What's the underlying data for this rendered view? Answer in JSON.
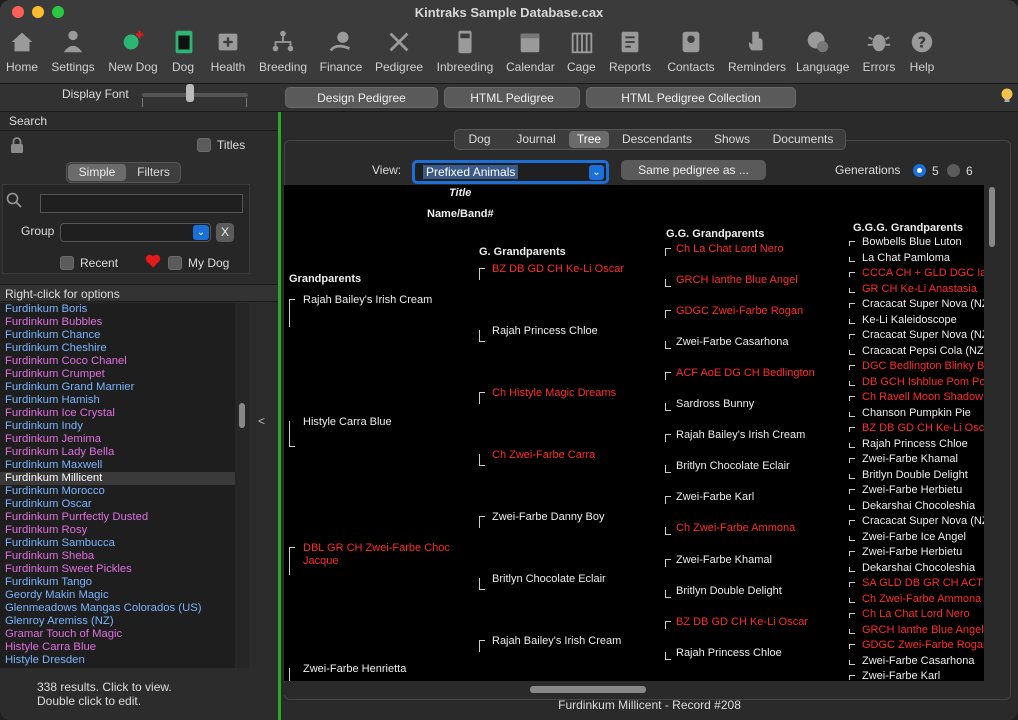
{
  "window": {
    "title": "Kintraks Sample Database.cax"
  },
  "toolbar": [
    {
      "label": "Home",
      "icon": "home-icon"
    },
    {
      "label": "Settings",
      "icon": "settings-person-icon"
    },
    {
      "label": "New Dog",
      "icon": "new-dog-icon"
    },
    {
      "label": "Dog",
      "icon": "dog-clipboard-icon"
    },
    {
      "label": "Health",
      "icon": "health-icon"
    },
    {
      "label": "Breeding",
      "icon": "breeding-icon"
    },
    {
      "label": "Finance",
      "icon": "finance-icon"
    },
    {
      "label": "Pedigree",
      "icon": "pedigree-icon"
    },
    {
      "label": "Inbreeding",
      "icon": "calculator-icon"
    },
    {
      "label": "Calendar",
      "icon": "calendar-icon"
    },
    {
      "label": "Cage",
      "icon": "cage-icon"
    },
    {
      "label": "Reports",
      "icon": "reports-icon"
    },
    {
      "label": "Contacts",
      "icon": "contacts-icon"
    },
    {
      "label": "Reminders",
      "icon": "reminders-icon"
    },
    {
      "label": "Language",
      "icon": "language-icon"
    },
    {
      "label": "Errors",
      "icon": "bug-icon"
    },
    {
      "label": "Help",
      "icon": "help-icon"
    }
  ],
  "fontbar": {
    "label": "Display Font",
    "design_pedigree": "Design Pedigree",
    "html_pedigree": "HTML Pedigree",
    "html_pedigree_collection": "HTML Pedigree Collection"
  },
  "sidebar": {
    "search_label": "Search",
    "titles_label": "Titles",
    "simple_tab": "Simple",
    "filters_tab": "Filters",
    "search_value": "",
    "group_label": "Group",
    "group_value": "",
    "clear_label": "X",
    "recent_label": "Recent",
    "mydog_label": "My Dog",
    "list_header": "Right-click for options",
    "results_line1": "338 results. Click to view.",
    "results_line2": "Double click to edit.",
    "collapse_label": "<",
    "dogs": [
      {
        "name": "Furdinkum Boris",
        "color": "#7ab4ff"
      },
      {
        "name": "Furdinkum Bubbles",
        "color": "#e070e0"
      },
      {
        "name": "Furdinkum Chance",
        "color": "#7ab4ff"
      },
      {
        "name": "Furdinkum Cheshire",
        "color": "#7ab4ff"
      },
      {
        "name": "Furdinkum Coco Chanel",
        "color": "#e070e0"
      },
      {
        "name": "Furdinkum Crumpet",
        "color": "#e070e0"
      },
      {
        "name": "Furdinkum Grand Marnier",
        "color": "#7ab4ff"
      },
      {
        "name": "Furdinkum Hamish",
        "color": "#7ab4ff"
      },
      {
        "name": "Furdinkum Ice Crystal",
        "color": "#e070e0"
      },
      {
        "name": "Furdinkum Indy",
        "color": "#7ab4ff"
      },
      {
        "name": "Furdinkum Jemima",
        "color": "#e070e0"
      },
      {
        "name": "Furdinkum Lady Bella",
        "color": "#e070e0"
      },
      {
        "name": "Furdinkum Maxwell",
        "color": "#7ab4ff"
      },
      {
        "name": "Furdinkum Millicent",
        "color": "#ffffff"
      },
      {
        "name": "Furdinkum Morocco",
        "color": "#7ab4ff"
      },
      {
        "name": "Furdinkum Oscar",
        "color": "#7ab4ff"
      },
      {
        "name": "Furdinkum Purrfectly Dusted",
        "color": "#e070e0"
      },
      {
        "name": "Furdinkum Rosy",
        "color": "#e070e0"
      },
      {
        "name": "Furdinkum Sambucca",
        "color": "#7ab4ff"
      },
      {
        "name": "Furdinkum Sheba",
        "color": "#e070e0"
      },
      {
        "name": "Furdinkum Sweet Pickles",
        "color": "#e070e0"
      },
      {
        "name": "Furdinkum Tango",
        "color": "#7ab4ff"
      },
      {
        "name": "Geordy Makin Magic",
        "color": "#7ab4ff"
      },
      {
        "name": "Glenmeadows Mangas Colorados (US)",
        "color": "#7ab4ff"
      },
      {
        "name": "Glenroy Aremiss (NZ)",
        "color": "#7ab4ff"
      },
      {
        "name": "Gramar Touch of Magic",
        "color": "#e070e0"
      },
      {
        "name": "Histyle Carra Blue",
        "color": "#e070e0"
      },
      {
        "name": "Histyle Dresden",
        "color": "#7ab4ff"
      }
    ],
    "selected_dog": "Furdinkum Millicent"
  },
  "tabs": [
    "Dog",
    "Journal",
    "Tree",
    "Descendants",
    "Shows",
    "Documents"
  ],
  "active_tab": "Tree",
  "view": {
    "label": "View:",
    "value": "Prefixed Animals",
    "same_pedigree": "Same pedigree as ...",
    "generations_label": "Generations",
    "gen5": "5",
    "gen6": "6",
    "selected_generations": 5
  },
  "tree": {
    "title_hdr": "Title",
    "name_hdr": "Name/Band#",
    "col_headers": [
      "Grandparents",
      "G. Grandparents",
      "G.G. Grandparents",
      "G.G.G. Grandparents"
    ],
    "grandparents": [
      {
        "name": "Rajah Bailey's Irish Cream",
        "red": false
      },
      {
        "name": "Histyle Carra Blue",
        "red": false
      },
      {
        "name": "DBL GR CH Zwei-Farbe Choc Jacque",
        "red": true
      },
      {
        "name": "Zwei-Farbe Henrietta",
        "red": false
      }
    ],
    "g_grandparents": [
      {
        "name": "BZ DB GD CH Ke-Li Oscar",
        "red": true
      },
      {
        "name": "Rajah Princess Chloe",
        "red": false
      },
      {
        "name": "Ch Histyle Magic Dreams",
        "red": true
      },
      {
        "name": "Ch Zwei-Farbe Carra",
        "red": true
      },
      {
        "name": "Zwei-Farbe Danny Boy",
        "red": false
      },
      {
        "name": "Britlyn Chocolate Eclair",
        "red": false
      },
      {
        "name": "Rajah Bailey's Irish Cream",
        "red": false
      }
    ],
    "gg_grandparents": [
      {
        "name": "Ch La Chat Lord Nero",
        "red": true
      },
      {
        "name": "GRCH Ianthe Blue Angel",
        "red": true
      },
      {
        "name": "GDGC Zwei-Farbe Rogan",
        "red": true
      },
      {
        "name": "Zwei-Farbe Casarhona",
        "red": false
      },
      {
        "name": "ACF AoE DG CH Bedlington",
        "red": true
      },
      {
        "name": "Sardross Bunny",
        "red": false
      },
      {
        "name": "Rajah Bailey's Irish Cream",
        "red": false
      },
      {
        "name": "Britlyn Chocolate Eclair",
        "red": false
      },
      {
        "name": "Zwei-Farbe Karl",
        "red": false
      },
      {
        "name": "Ch Zwei-Farbe Ammona",
        "red": true
      },
      {
        "name": "Zwei-Farbe Khamal",
        "red": false
      },
      {
        "name": "Britlyn Double Delight",
        "red": false
      },
      {
        "name": "BZ DB GD CH Ke-Li Oscar",
        "red": true
      },
      {
        "name": "Rajah Princess Chloe",
        "red": false
      }
    ],
    "ggg_grandparents": [
      {
        "name": "Bowbells Blue Luton",
        "red": false
      },
      {
        "name": "La Chat Pamloma",
        "red": false
      },
      {
        "name": "CCCA CH + GLD DGC Ias",
        "red": true
      },
      {
        "name": "GR CH Ke-Li Anastasia",
        "red": true
      },
      {
        "name": "Cracacat Super Nova (NZ",
        "red": false
      },
      {
        "name": "Ke-Li Kaleidoscope",
        "red": false
      },
      {
        "name": "Cracacat Super Nova (NZ",
        "red": false
      },
      {
        "name": "Cracacat Pepsi Cola (NZ",
        "red": false
      },
      {
        "name": "DGC Bedlington Blinky B",
        "red": true
      },
      {
        "name": "DB GCH Ishblue Pom Poi",
        "red": true
      },
      {
        "name": "Ch Ravell Moon Shadow",
        "red": true
      },
      {
        "name": "Chanson Pumpkin Pie",
        "red": false
      },
      {
        "name": "BZ DB GD CH Ke-Li Osca",
        "red": true
      },
      {
        "name": "Rajah Princess Chloe",
        "red": false
      },
      {
        "name": "Zwei-Farbe Khamal",
        "red": false
      },
      {
        "name": "Britlyn Double Delight",
        "red": false
      },
      {
        "name": "Zwei-Farbe Herbietu",
        "red": false
      },
      {
        "name": "Dekarshai Chocoleshia",
        "red": false
      },
      {
        "name": "Cracacat Super Nova (NZ",
        "red": false
      },
      {
        "name": "Zwei-Farbe Ice Angel",
        "red": false
      },
      {
        "name": "Zwei-Farbe Herbietu",
        "red": false
      },
      {
        "name": "Dekarshai Chocoleshia",
        "red": false
      },
      {
        "name": "SA GLD DB GR CH ACT A",
        "red": true
      },
      {
        "name": "Ch Zwei-Farbe Ammona",
        "red": true
      },
      {
        "name": "Ch La Chat Lord Nero",
        "red": true
      },
      {
        "name": "GRCH Ianthe Blue Angel",
        "red": true
      },
      {
        "name": "GDGC Zwei-Farbe Rogan",
        "red": true
      },
      {
        "name": "Zwei-Farbe Casarhona",
        "red": false
      },
      {
        "name": "Zwei-Farbe Karl",
        "red": false
      }
    ]
  },
  "footer": "Furdinkum Millicent - Record #208"
}
